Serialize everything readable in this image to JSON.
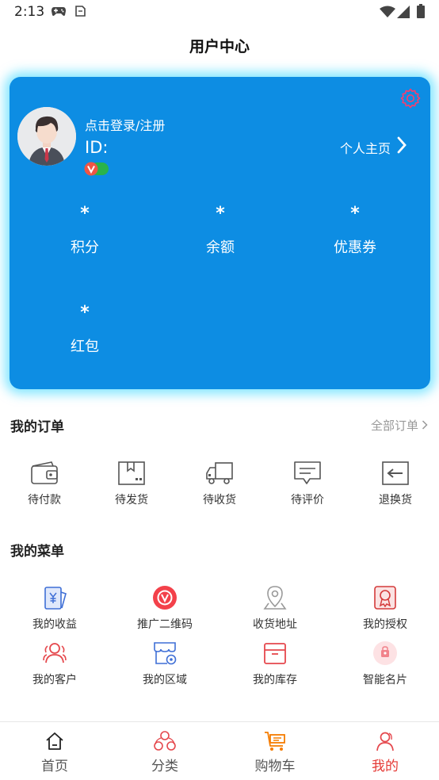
{
  "status": {
    "time": "2:13"
  },
  "header": {
    "title": "用户中心"
  },
  "profile": {
    "login_text": "点击登录/注册",
    "id_label": "ID:",
    "homepage_link": "个人主页",
    "stats": [
      {
        "value": "*",
        "label": "积分"
      },
      {
        "value": "*",
        "label": "余额"
      },
      {
        "value": "*",
        "label": "优惠券"
      },
      {
        "value": "*",
        "label": "红包"
      }
    ]
  },
  "orders": {
    "title": "我的订单",
    "all_link": "全部订单",
    "items": [
      {
        "label": "待付款",
        "icon": "wallet-icon"
      },
      {
        "label": "待发货",
        "icon": "package-icon"
      },
      {
        "label": "待收货",
        "icon": "truck-icon"
      },
      {
        "label": "待评价",
        "icon": "comment-icon"
      },
      {
        "label": "退换货",
        "icon": "return-icon"
      }
    ]
  },
  "menu": {
    "title": "我的菜单",
    "items": [
      {
        "label": "我的收益",
        "icon": "earnings-icon"
      },
      {
        "label": "推广二维码",
        "icon": "qrcode-icon"
      },
      {
        "label": "收货地址",
        "icon": "location-icon"
      },
      {
        "label": "我的授权",
        "icon": "certificate-icon"
      },
      {
        "label": "我的客户",
        "icon": "customers-icon"
      },
      {
        "label": "我的区域",
        "icon": "region-icon"
      },
      {
        "label": "我的库存",
        "icon": "inventory-icon"
      },
      {
        "label": "智能名片",
        "icon": "business-card-icon"
      }
    ]
  },
  "tabbar": {
    "items": [
      {
        "label": "首页",
        "icon": "home-icon"
      },
      {
        "label": "分类",
        "icon": "category-icon"
      },
      {
        "label": "购物车",
        "icon": "cart-icon"
      },
      {
        "label": "我的",
        "icon": "profile-icon"
      }
    ],
    "active": "我的"
  },
  "colors": {
    "card_bg": "#0d8de3",
    "accent_red": "#e53935",
    "accent_orange": "#f57c00",
    "icon_blue": "#3f6fd6",
    "icon_gray": "#555555"
  }
}
